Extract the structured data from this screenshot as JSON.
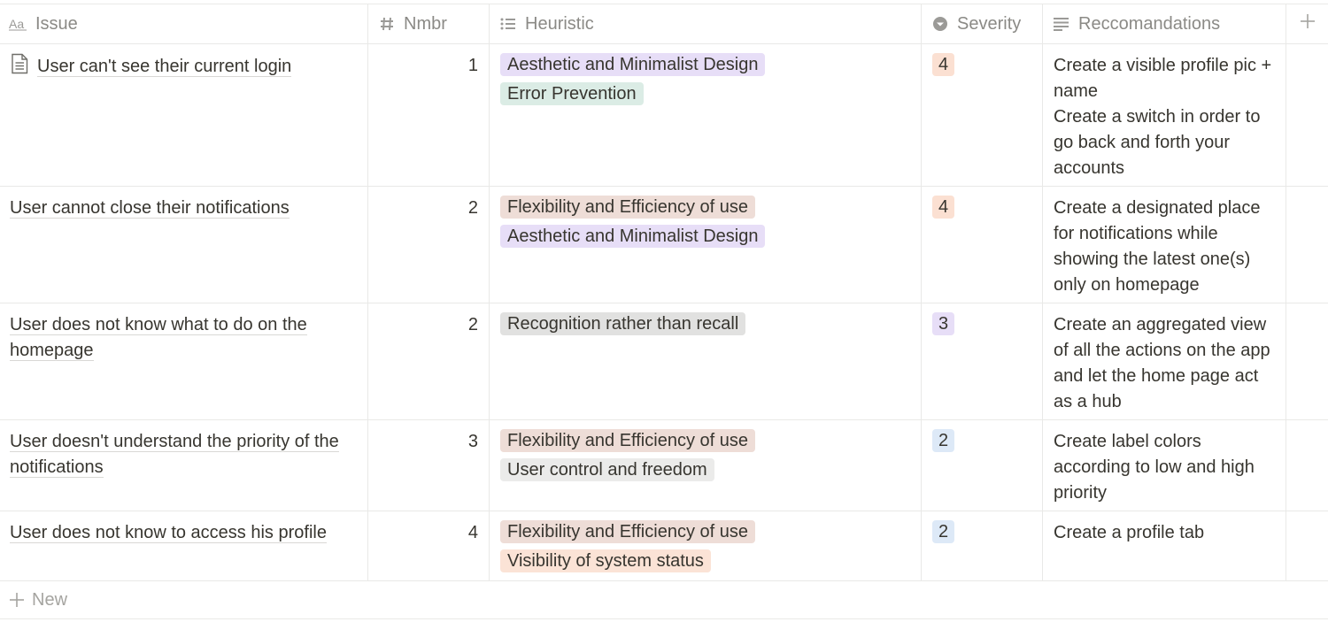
{
  "columns": {
    "issue": "Issue",
    "nmbr": "Nmbr",
    "heuristic": "Heuristic",
    "severity": "Severity",
    "recommendations": "Reccomandations"
  },
  "rows": [
    {
      "issue": "User can't see their current login",
      "nmbr": "1",
      "tags": [
        {
          "label": "Aesthetic and Minimalist Design",
          "color": "#e7def7"
        },
        {
          "label": "Error Prevention",
          "color": "#dbece5"
        }
      ],
      "severity": {
        "value": "4",
        "color": "#fbe0d2"
      },
      "recommendations": [
        "Create a visible profile pic + name",
        "Create a switch in order to go back and forth your accounts"
      ]
    },
    {
      "issue": "User cannot close their notifications",
      "nmbr": "2",
      "tags": [
        {
          "label": "Flexibility and Efficiency of use",
          "color": "#eeddd7"
        },
        {
          "label": "Aesthetic and Minimalist Design",
          "color": "#e7def7"
        }
      ],
      "severity": {
        "value": "4",
        "color": "#fbe0d2"
      },
      "recommendations": [
        "Create a designated place for notifications while showing the latest one(s) only on homepage"
      ]
    },
    {
      "issue": "User does not know what to do on the homepage",
      "nmbr": "2",
      "tags": [
        {
          "label": "Recognition rather than recall",
          "color": "#e1e1e0"
        }
      ],
      "severity": {
        "value": "3",
        "color": "#e7def7"
      },
      "recommendations": [
        "Create an aggregated view of all the actions on the app and let the home page act as a hub"
      ]
    },
    {
      "issue": "User doesn't understand the priority of the notifications",
      "nmbr": "3",
      "tags": [
        {
          "label": "Flexibility and Efficiency of use",
          "color": "#eeddd7"
        },
        {
          "label": "User control and freedom",
          "color": "#ebebea"
        }
      ],
      "severity": {
        "value": "2",
        "color": "#dde9f7"
      },
      "recommendations": [
        "Create label colors according to low and high priority"
      ]
    },
    {
      "issue": "User does not know to access his profile",
      "nmbr": "4",
      "tags": [
        {
          "label": "Flexibility and Efficiency of use",
          "color": "#eeddd7"
        },
        {
          "label": "Visibility of system status",
          "color": "#fbe3d6"
        }
      ],
      "severity": {
        "value": "2",
        "color": "#dde9f7"
      },
      "recommendations": [
        "Create a profile tab"
      ]
    }
  ],
  "new_label": "New",
  "icons": {
    "issue": "text-aa-icon",
    "nmbr": "hash-icon",
    "heuristic": "list-icon",
    "severity": "select-chevron-icon",
    "recommendations": "text-lines-icon",
    "add_column": "plus-icon",
    "page": "document-icon"
  }
}
